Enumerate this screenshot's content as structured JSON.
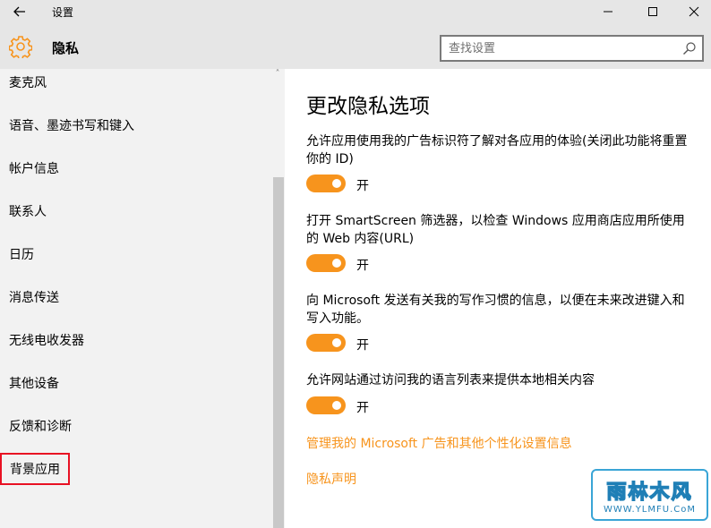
{
  "window": {
    "title": "设置"
  },
  "header": {
    "title": "隐私",
    "search_placeholder": "查找设置"
  },
  "sidebar": {
    "scroll_up_glyph": "˄",
    "items": [
      {
        "label": "麦克风"
      },
      {
        "label": "语音、墨迹书写和键入"
      },
      {
        "label": "帐户信息"
      },
      {
        "label": "联系人"
      },
      {
        "label": "日历"
      },
      {
        "label": "消息传送"
      },
      {
        "label": "无线电收发器"
      },
      {
        "label": "其他设备"
      },
      {
        "label": "反馈和诊断"
      },
      {
        "label": "背景应用",
        "selected": true
      }
    ]
  },
  "main": {
    "title": "更改隐私选项",
    "settings": [
      {
        "description": "允许应用使用我的广告标识符了解对各应用的体验(关闭此功能将重置你的 ID)",
        "state_label": "开",
        "on": true
      },
      {
        "description": "打开 SmartScreen 筛选器，以检查 Windows 应用商店应用所使用的 Web 内容(URL)",
        "state_label": "开",
        "on": true
      },
      {
        "description": "向 Microsoft 发送有关我的写作习惯的信息，以便在未来改进键入和写入功能。",
        "state_label": "开",
        "on": true
      },
      {
        "description": "允许网站通过访问我的语言列表来提供本地相关内容",
        "state_label": "开",
        "on": true
      }
    ],
    "links": [
      {
        "label": "管理我的 Microsoft 广告和其他个性化设置信息"
      },
      {
        "label": "隐私声明"
      }
    ]
  },
  "watermark": {
    "text": "雨林木风",
    "url_text": "WWW.YLMFU.CoM"
  },
  "colors": {
    "accent": "#f7941d",
    "chrome": "#e6e6e6",
    "sidebar": "#f2f2f2",
    "selected_outline": "#e81123"
  },
  "icons": {
    "back": "back-arrow-icon",
    "gear": "gear-icon",
    "search": "search-icon",
    "minimize": "minimize-icon",
    "maximize": "maximize-icon",
    "close": "close-icon"
  }
}
